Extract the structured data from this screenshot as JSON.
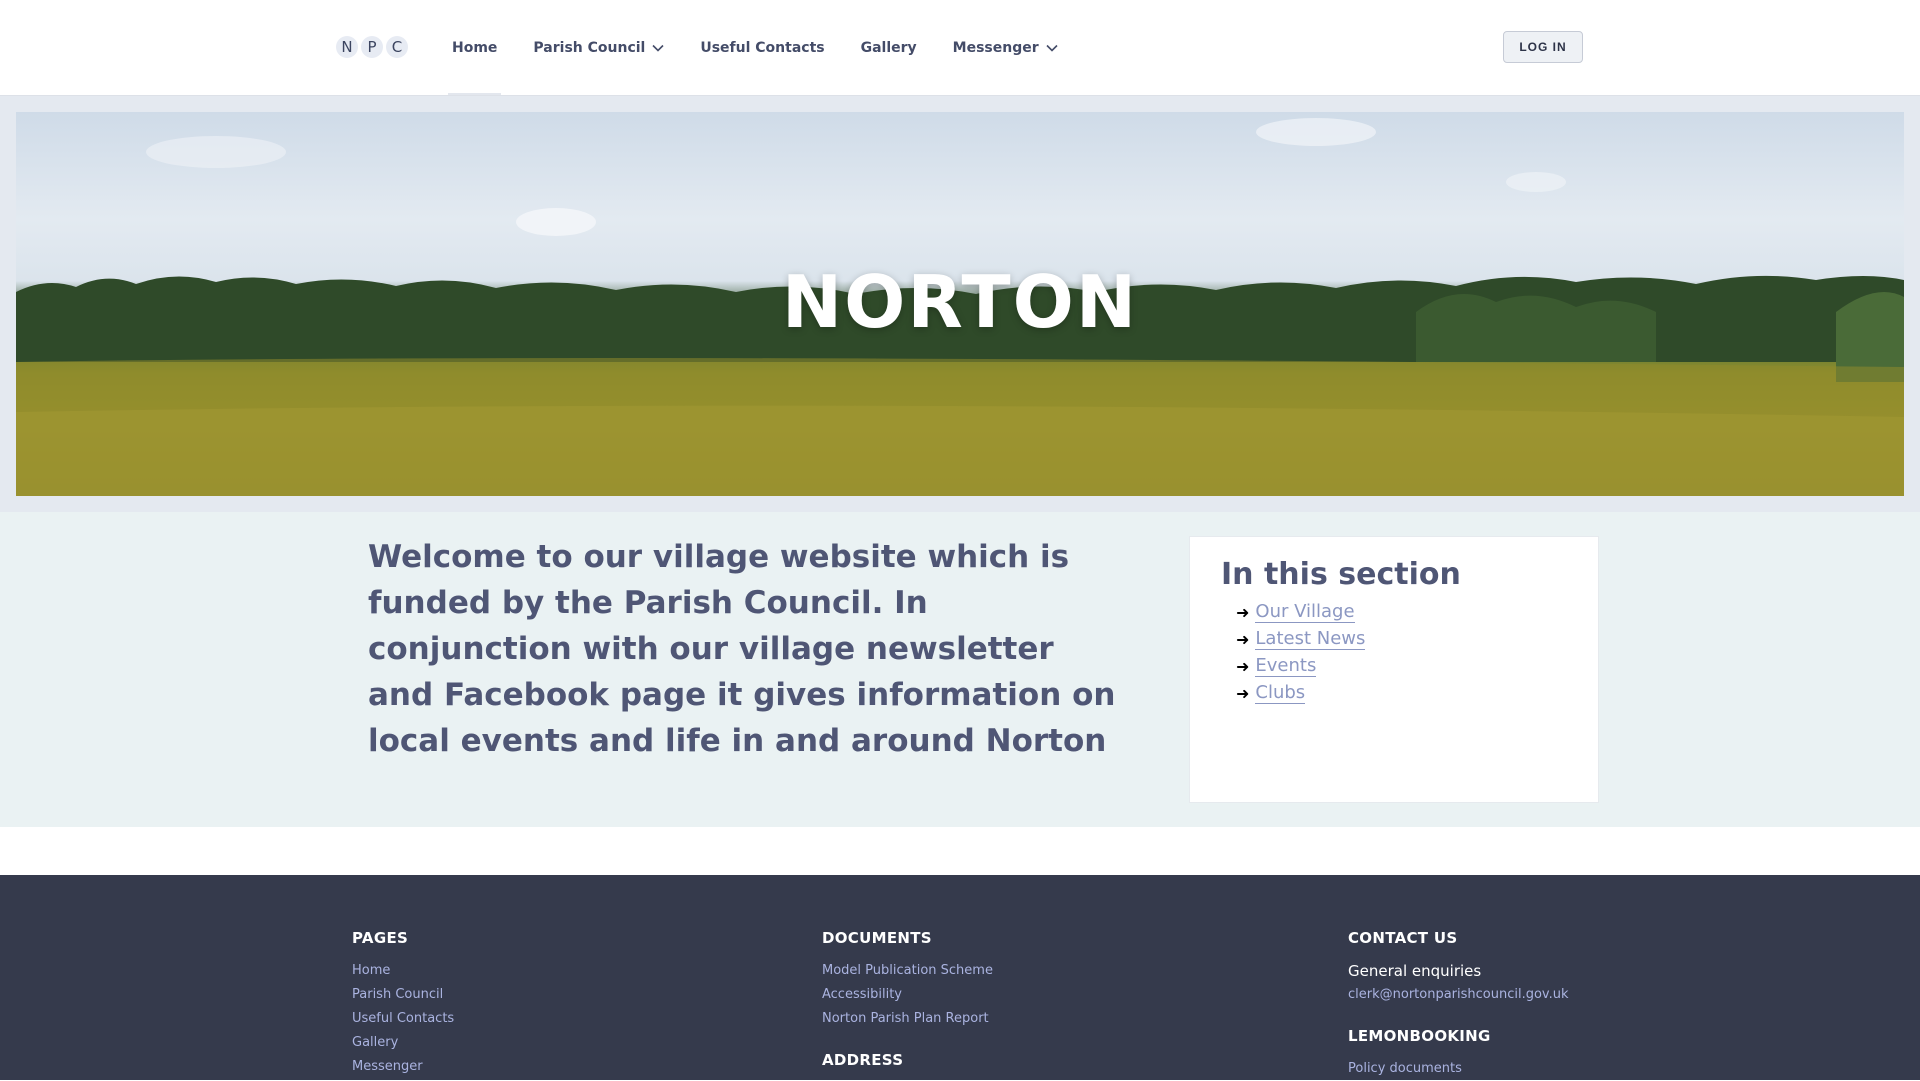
{
  "header": {
    "logo_letters": [
      "N",
      "P",
      "C"
    ],
    "nav": [
      {
        "label": "Home",
        "dropdown": false,
        "active": true
      },
      {
        "label": "Parish Council",
        "dropdown": true
      },
      {
        "label": "Useful Contacts",
        "dropdown": false
      },
      {
        "label": "Gallery",
        "dropdown": false
      },
      {
        "label": "Messenger",
        "dropdown": true
      }
    ],
    "login_label": "LOG IN"
  },
  "hero": {
    "title": "NORTON"
  },
  "main": {
    "welcome_text": "Welcome to our village website which is funded by the Parish Council. In conjunction with our village newsletter and Facebook page it gives information on local events and life in and around Norton",
    "section": {
      "title": "In this section",
      "links": [
        "Our Village",
        "Latest News",
        "Events",
        "Clubs"
      ]
    }
  },
  "footer": {
    "pages": {
      "heading": "PAGES",
      "links": [
        "Home",
        "Parish Council",
        "Useful Contacts",
        "Gallery",
        "Messenger"
      ]
    },
    "documents": {
      "heading": "DOCUMENTS",
      "links": [
        "Model Publication Scheme",
        "Accessibility",
        "Norton Parish Plan Report"
      ],
      "address_heading": "ADDRESS"
    },
    "contact": {
      "heading": "CONTACT US",
      "general_label": "General enquiries",
      "email": "clerk@nortonparishcouncil.gov.uk",
      "lemonbooking_heading": "LEMONBOOKING",
      "policy_link": "Policy documents"
    }
  },
  "colors": {
    "footer_bg": "#353a4c",
    "content_bg": "#eaf2f3",
    "link": "#8b97c2"
  }
}
